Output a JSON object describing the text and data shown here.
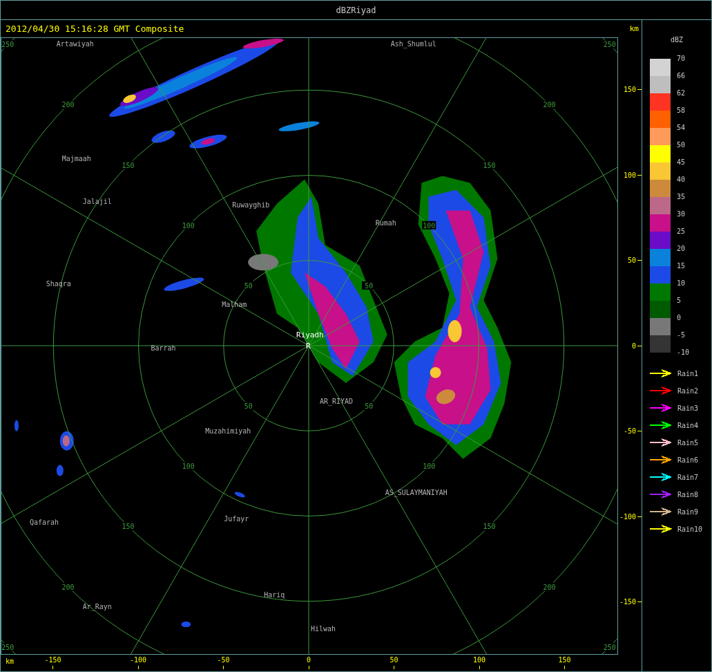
{
  "window": {
    "title": "dBZRiyad"
  },
  "header": {
    "timestamp": "2012/04/30 15:16:28 GMT Composite"
  },
  "map": {
    "range_rings": [
      {
        "labels": [
          "50",
          "50",
          "50",
          "50"
        ]
      },
      {
        "labels": [
          "100",
          "100",
          "100",
          "100"
        ]
      },
      {
        "labels": [
          "150",
          "150",
          "150",
          "150"
        ]
      },
      {
        "labels": [
          "200",
          "200",
          "200",
          "200"
        ]
      },
      {
        "labels": [
          "250",
          "250",
          "250",
          "250"
        ]
      }
    ],
    "places": [
      {
        "name": "Artawiyah",
        "kind": "place"
      },
      {
        "name": "Ash_Shumlul",
        "kind": "place"
      },
      {
        "name": "Majmaah",
        "kind": "place"
      },
      {
        "name": "Jalajil",
        "kind": "place"
      },
      {
        "name": "Ruwayghib",
        "kind": "place"
      },
      {
        "name": "Rumah",
        "kind": "place"
      },
      {
        "name": "Shaqra",
        "kind": "place"
      },
      {
        "name": "Malham",
        "kind": "place"
      },
      {
        "name": "Riyadh",
        "kind": "site"
      },
      {
        "name": "R",
        "kind": "site"
      },
      {
        "name": "Barrah",
        "kind": "place"
      },
      {
        "name": "AR_RIYAD",
        "kind": "place"
      },
      {
        "name": "Muzahimiyah",
        "kind": "place"
      },
      {
        "name": "AS_SULAYMANIYAH",
        "kind": "place"
      },
      {
        "name": "Qafarah",
        "kind": "place"
      },
      {
        "name": "Jufayr",
        "kind": "place"
      },
      {
        "name": "Hariq",
        "kind": "place"
      },
      {
        "name": "Ar_Rayn",
        "kind": "place"
      },
      {
        "name": "Hilwah",
        "kind": "place"
      }
    ]
  },
  "y_axis": {
    "unit": "km",
    "ticks": [
      "150",
      "100",
      "50",
      "0",
      "-50",
      "-100",
      "-150"
    ]
  },
  "x_axis": {
    "unit": "km",
    "ticks": [
      "-150",
      "-100",
      "-50",
      "0",
      "50",
      "100",
      "150"
    ]
  },
  "legend": {
    "title": "dBZ",
    "bins": [
      {
        "color": "#d3d3d3"
      },
      {
        "color": "#bebebe"
      },
      {
        "color": "#ff3322"
      },
      {
        "color": "#ff6000"
      },
      {
        "color": "#ff9a5a"
      },
      {
        "color": "#ffff00"
      },
      {
        "color": "#f9c634"
      },
      {
        "color": "#cd8a3c"
      },
      {
        "color": "#bc6888"
      },
      {
        "color": "#c8108a"
      },
      {
        "color": "#6a0cc8"
      },
      {
        "color": "#0a82dc"
      },
      {
        "color": "#1c4ae6"
      },
      {
        "color": "#007800"
      },
      {
        "color": "#005a00"
      },
      {
        "color": "#787878"
      },
      {
        "color": "#343434"
      }
    ],
    "scale_labels": [
      "70",
      "66",
      "62",
      "58",
      "54",
      "50",
      "45",
      "40",
      "35",
      "30",
      "25",
      "20",
      "15",
      "10",
      "5",
      "0",
      "-5",
      "-10"
    ],
    "tracks": [
      {
        "name": "Rain1",
        "color": "#ffff00"
      },
      {
        "name": "Rain2",
        "color": "#ff0000"
      },
      {
        "name": "Rain3",
        "color": "#ff00ff"
      },
      {
        "name": "Rain4",
        "color": "#00ff00"
      },
      {
        "name": "Rain5",
        "color": "#ffc0cb"
      },
      {
        "name": "Rain6",
        "color": "#ffa500"
      },
      {
        "name": "Rain7",
        "color": "#00ffff"
      },
      {
        "name": "Rain8",
        "color": "#a020f0"
      },
      {
        "name": "Rain9",
        "color": "#d2b48c"
      },
      {
        "name": "Rain10",
        "color": "#ffff00"
      }
    ]
  }
}
